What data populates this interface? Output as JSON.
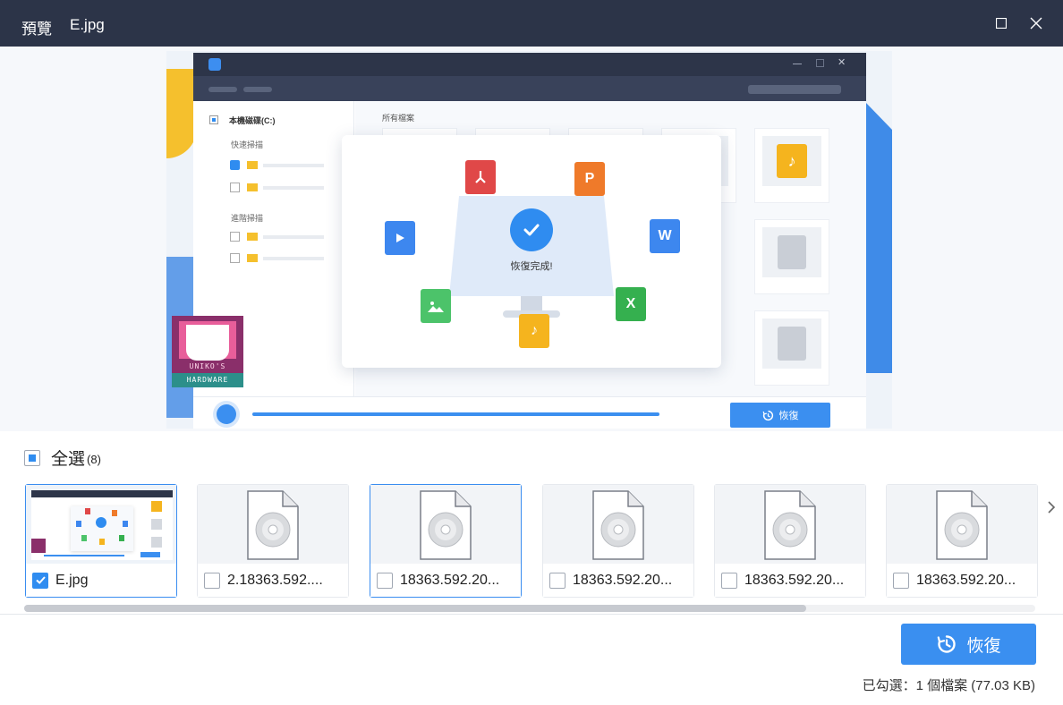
{
  "window": {
    "title": "預覽",
    "filename": "E.jpg",
    "maximize_icon": "maximize-icon",
    "close_icon": "close-icon"
  },
  "preview_image": {
    "sidebar_drive": "本機磁碟(C:)",
    "sidebar_quick_scan": "快速掃描",
    "sidebar_deep_scan": "進階掃描",
    "main_header": "所有檔案",
    "dialog_text": "恢復完成!",
    "restore_label": "恢復",
    "logo_text_top": "UNIKO'S",
    "logo_text_bottom": "HARDWARE",
    "file_icons": [
      {
        "name": "pdf-icon",
        "letter": "",
        "color": "#e04848"
      },
      {
        "name": "powerpoint-icon",
        "letter": "P",
        "color": "#ef7a2a"
      },
      {
        "name": "video-icon",
        "letter": "",
        "color": "#3d87ef"
      },
      {
        "name": "word-icon",
        "letter": "W",
        "color": "#3d87ef"
      },
      {
        "name": "image-icon",
        "letter": "",
        "color": "#4cc36a"
      },
      {
        "name": "excel-icon",
        "letter": "X",
        "color": "#35b04f"
      },
      {
        "name": "music-icon",
        "letter": "",
        "color": "#f5b41e"
      }
    ]
  },
  "select_all": {
    "label": "全選",
    "count": "(8)"
  },
  "thumbnails": [
    {
      "name": "E.jpg",
      "checked": true,
      "selected": true,
      "type": "image"
    },
    {
      "name": "2.18363.592....",
      "checked": false,
      "selected": false,
      "type": "disc"
    },
    {
      "name": "18363.592.20...",
      "checked": false,
      "selected": true,
      "type": "disc"
    },
    {
      "name": "18363.592.20...",
      "checked": false,
      "selected": false,
      "type": "disc"
    },
    {
      "name": "18363.592.20...",
      "checked": false,
      "selected": false,
      "type": "disc"
    },
    {
      "name": "18363.592.20...",
      "checked": false,
      "selected": false,
      "type": "disc"
    }
  ],
  "footer": {
    "restore_button": "恢復",
    "status": "已勾選：1 個檔案 (77.03 KB)"
  },
  "colors": {
    "accent": "#3a8ff0",
    "titlebar": "#2c3448"
  }
}
